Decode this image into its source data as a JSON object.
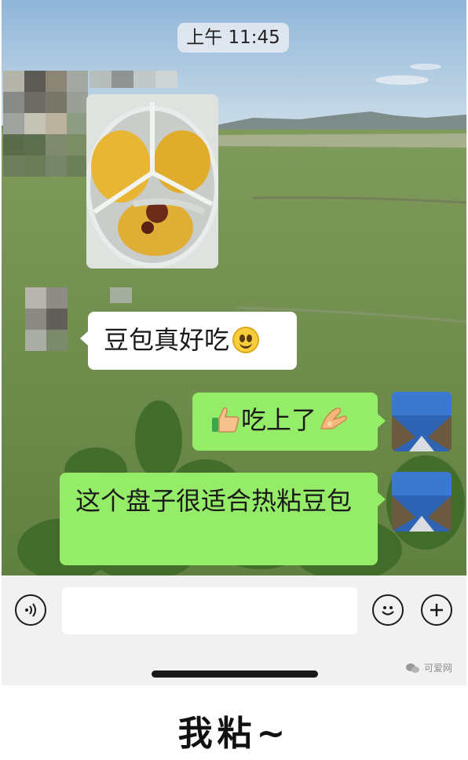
{
  "status": {
    "time_label": "上午 11:45"
  },
  "messages": [
    {
      "type": "image",
      "direction": "incoming",
      "alt_icon": "food-photo-icon"
    },
    {
      "type": "text",
      "direction": "incoming",
      "text": "豆包真好吃",
      "emoji": "smile-emoji"
    },
    {
      "type": "text",
      "direction": "outgoing",
      "text": "吃上了",
      "emoji_before": "thumbs-up-emoji",
      "emoji_after": "ok-hand-emoji"
    },
    {
      "type": "text",
      "direction": "outgoing",
      "text": "这个盘子很适合热粘豆包"
    }
  ],
  "input_bar": {
    "voice_icon": "voice-icon",
    "text_value": "",
    "emoji_icon": "emoji-icon",
    "more_icon": "plus-icon",
    "watermark": "可爱网"
  },
  "caption": "我粘~",
  "colors": {
    "outgoing_bubble": "#95ec69",
    "incoming_bubble": "#ffffff",
    "input_bar_bg": "#f1f1f1"
  }
}
